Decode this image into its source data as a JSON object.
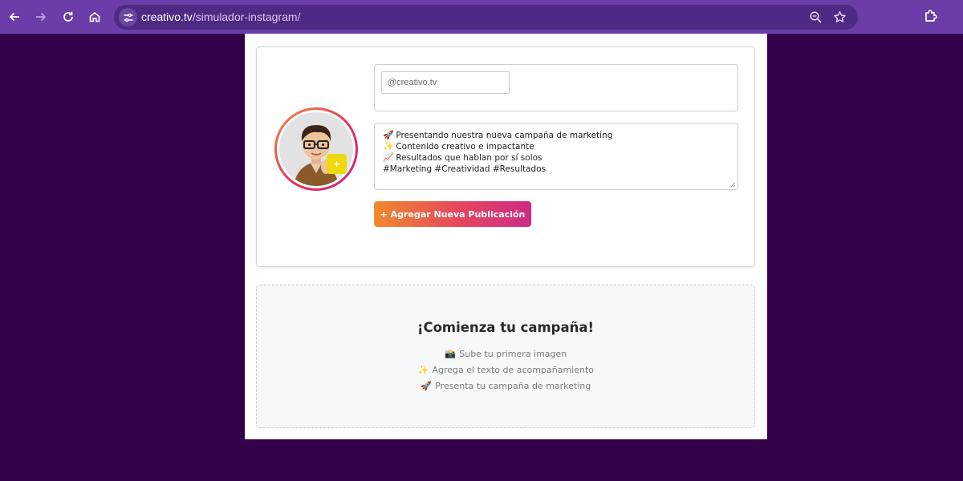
{
  "browser": {
    "url_domain": "creativo.tv",
    "url_path": "/simulador-instagram/"
  },
  "composer": {
    "username_value": "@creativo.tv",
    "avatar_add_label": "+",
    "caption_lines": [
      {
        "icon": "🚀",
        "text": "Presentando nuestra nueva campaña de marketing"
      },
      {
        "icon": "✨",
        "text": "Contenido creativo e impactante"
      },
      {
        "icon": "📈",
        "text": "Resultados que hablan por sí solos"
      },
      {
        "icon": "",
        "text": "#Marketing #Creatividad #Resultados"
      }
    ],
    "add_button_label": "+ Agregar Nueva Publicación"
  },
  "empty_state": {
    "title": "¡Comienza tu campaña!",
    "steps": [
      {
        "icon": "📸",
        "text": "Sube tu primera imagen"
      },
      {
        "icon": "✨",
        "text": "Agrega el texto de acompañamiento"
      },
      {
        "icon": "🚀",
        "text": "Presenta tu campaña de marketing"
      }
    ]
  },
  "colors": {
    "page_background": "#35004a",
    "browser_bar": "#6a3da8",
    "button_gradient_start": "#f08a2c",
    "button_gradient_end": "#cd2a86",
    "avatar_badge": "#f0d90a"
  }
}
